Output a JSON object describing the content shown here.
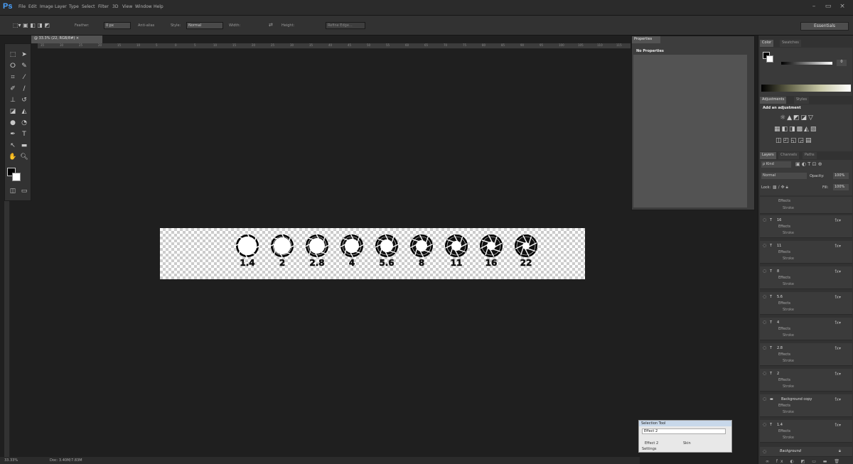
{
  "menubar": {
    "logo": "Ps",
    "items": [
      "File",
      "Edit",
      "Image",
      "Layer",
      "Type",
      "Select",
      "Filter",
      "3D",
      "View",
      "Window",
      "Help"
    ],
    "window_controls": [
      "–",
      "▭",
      "×"
    ]
  },
  "options": {
    "feather_label": "Feather:",
    "feather_value": "0 px",
    "antialias_label": "Anti-alias",
    "style_label": "Style:",
    "style_value": "Normal",
    "width_label": "Width:",
    "height_label": "Height:",
    "refine_edge": "Refine Edge...",
    "workspace": "Essentials"
  },
  "document": {
    "tab": "@ 33.3% (22, RGB/8#) ×",
    "ruler_ticks": [
      "35",
      "30",
      "25",
      "20",
      "15",
      "10",
      "5",
      "0",
      "5",
      "10",
      "15",
      "20",
      "25",
      "30",
      "35",
      "40",
      "45",
      "50",
      "55",
      "60",
      "65",
      "70",
      "75",
      "80",
      "85",
      "90",
      "95",
      "100",
      "105",
      "110",
      "115"
    ],
    "stops": [
      "1.4",
      "2",
      "2.8",
      "4",
      "5.6",
      "8",
      "11",
      "16",
      "22"
    ]
  },
  "properties": {
    "tab": "Properties",
    "text": "No Properties"
  },
  "color_panel": {
    "tabs": [
      "Color",
      "Swatches"
    ],
    "value": "0"
  },
  "adjustments": {
    "tabs": [
      "Adjustments",
      "Styles"
    ],
    "heading": "Add an adjustment"
  },
  "layers": {
    "tabs": [
      "Layers",
      "Channels",
      "Paths"
    ],
    "kind": "ρ Kind",
    "blend": "Normal",
    "opacity_label": "Opacity:",
    "opacity_value": "100%",
    "lock_label": "Lock:",
    "fill_label": "Fill:",
    "fill_value": "100%",
    "effects_label": "Effects",
    "stroke_label": "Stroke",
    "top_effects": [
      "Effects",
      "Stroke"
    ],
    "rows": [
      "16",
      "11",
      "8",
      "5.6",
      "4",
      "2.8",
      "2",
      "Background copy",
      "1.4"
    ],
    "background": "Background"
  },
  "selection_panel": {
    "title": "Selection Tool",
    "field": "Effect 2",
    "row_a": "Effect 2",
    "row_b": "Skin",
    "settings": "Settings"
  },
  "status": {
    "zoom": "33.33%",
    "doc": "Doc: 3.40M/7.83M"
  }
}
